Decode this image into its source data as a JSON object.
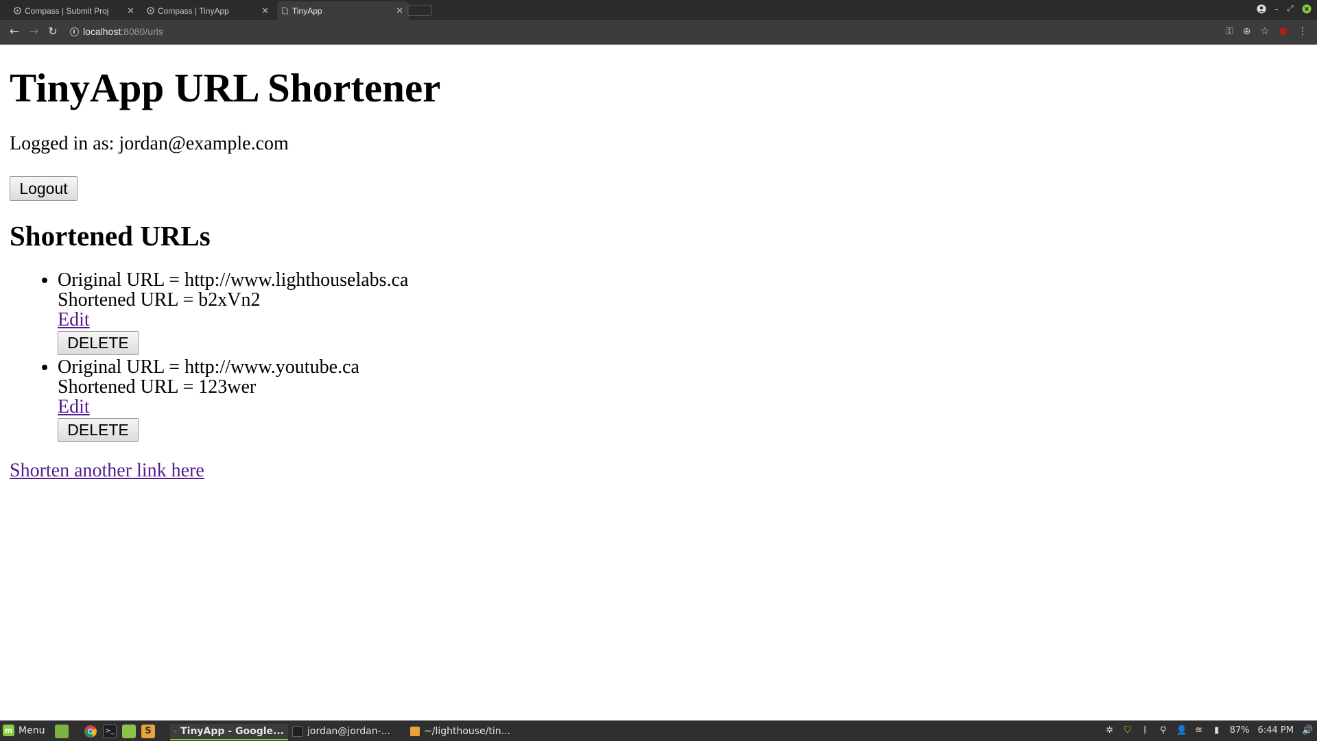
{
  "browser": {
    "tabs": [
      {
        "title": "Compass | Submit Proj",
        "active": false
      },
      {
        "title": "Compass | TinyApp",
        "active": false
      },
      {
        "title": "TinyApp",
        "active": true
      }
    ],
    "url_host": "localhost",
    "url_path": ":8080/urls"
  },
  "page": {
    "title": "TinyApp URL Shortener",
    "logged_in": "Logged in as: jordan@example.com",
    "logout_label": "Logout",
    "section_title": "Shortened URLs",
    "urls": [
      {
        "original": "Original URL = http://www.lighthouselabs.ca",
        "shortened": "Shortened URL = b2xVn2",
        "edit_label": "Edit",
        "delete_label": "DELETE"
      },
      {
        "original": "Original URL = http://www.youtube.ca",
        "shortened": "Shortened URL = 123wer",
        "edit_label": "Edit",
        "delete_label": "DELETE"
      }
    ],
    "shorten_link": "Shorten another link here"
  },
  "taskbar": {
    "menu_label": "Menu",
    "tasks": [
      {
        "title": "TinyApp - Google...",
        "active": true
      },
      {
        "title": "jordan@jordan-...",
        "active": false
      },
      {
        "title": "~/lighthouse/tin...",
        "active": false
      }
    ],
    "battery": "87%",
    "clock": "6:44 PM"
  },
  "colors": {
    "link_visited": "#551a8b",
    "chrome_dark": "#2b2b2b",
    "chrome_toolbar": "#3c3c3c",
    "mint_green": "#87cf3e"
  }
}
